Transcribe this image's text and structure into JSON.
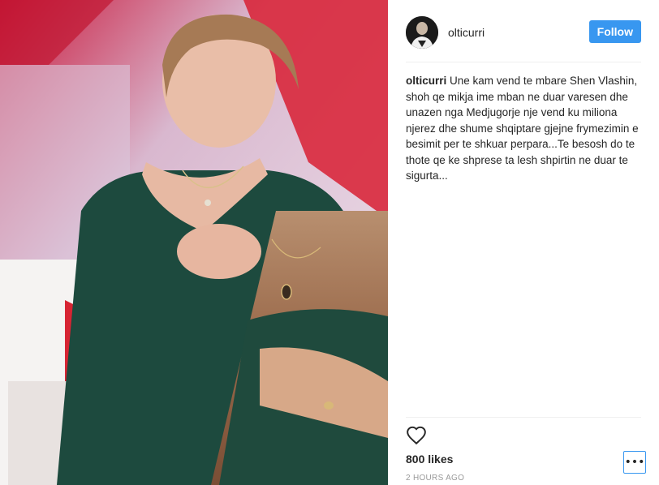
{
  "post": {
    "username": "olticurri",
    "follow_label": "Follow",
    "caption_user": "olticurri",
    "caption_text": "Une kam vend te mbare Shen Vlashin, shoh qe mikja ime mban ne duar varesen dhe unazen nga Medjugorje nje vend ku miliona njerez dhe shume shqiptare gjejne frymezimin e besimit per te shkuar perpara...Te besosh do te thote qe ke shprese ta lesh shpirtin ne duar te sigurta...",
    "likes": "800 likes",
    "time": "2 HOURS AGO",
    "more_label": "•••"
  },
  "icons": {
    "heart": "heart-icon",
    "more": "more-options-icon",
    "avatar": "avatar"
  },
  "colors": {
    "follow_button": "#3897f0",
    "dress": "#1d4a3e",
    "backdrop_red": "#c8202c"
  }
}
